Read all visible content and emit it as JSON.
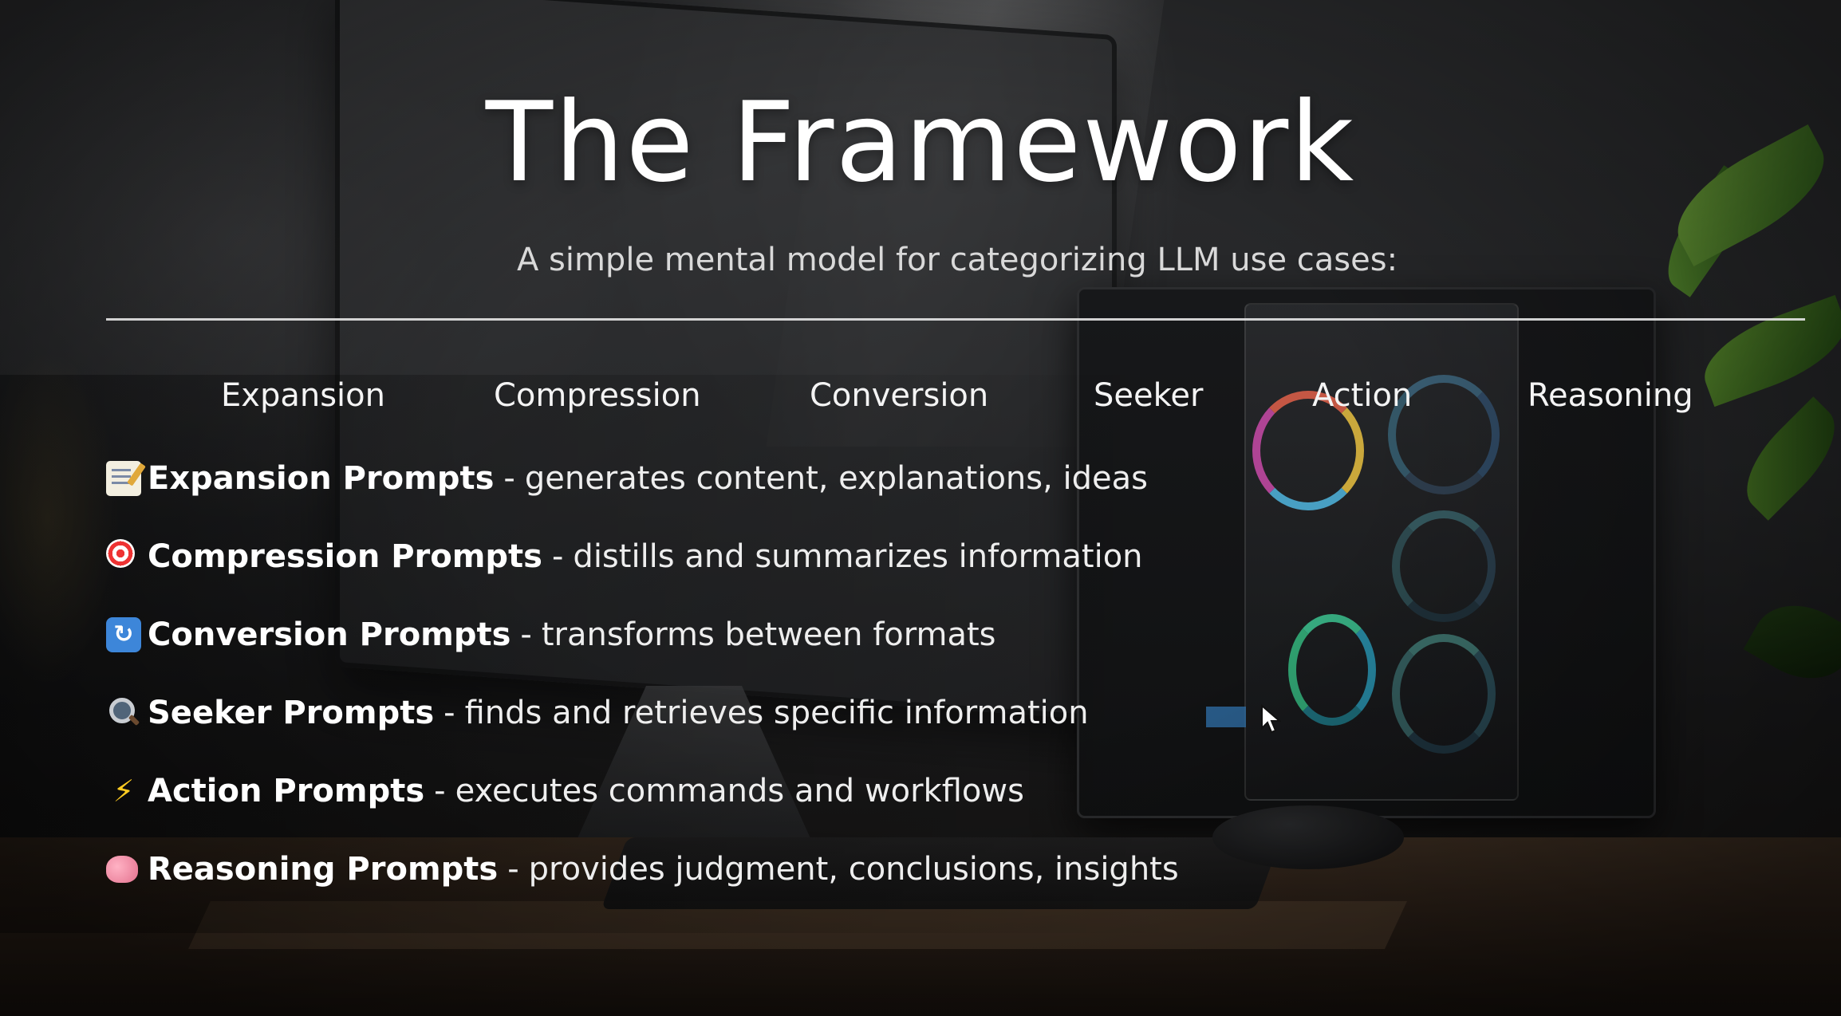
{
  "slide": {
    "title": "The Framework",
    "subtitle": "A simple mental model for categorizing LLM use cases:"
  },
  "categories": [
    "Expansion",
    "Compression",
    "Conversion",
    "Seeker",
    "Action",
    "Reasoning"
  ],
  "prompts": [
    {
      "icon": "memo-icon",
      "name": "Expansion Prompts",
      "separator": "-",
      "description": "generates content, explanations, ideas"
    },
    {
      "icon": "target-icon",
      "name": "Compression Prompts",
      "separator": "-",
      "description": "distills and summarizes information"
    },
    {
      "icon": "cycle-arrows-icon",
      "name": "Conversion Prompts",
      "separator": "-",
      "description": "transforms between formats"
    },
    {
      "icon": "magnifying-glass-icon",
      "name": "Seeker Prompts",
      "separator": "-",
      "description": "finds and retrieves specific information"
    },
    {
      "icon": "lightning-bolt-icon",
      "name": "Action Prompts",
      "separator": "-",
      "description": "executes commands and workflows"
    },
    {
      "icon": "brain-icon",
      "name": "Reasoning Prompts",
      "separator": "-",
      "description": "provides judgment, conclusions, insights"
    }
  ],
  "colors": {
    "text": "#ffffff",
    "divider": "#e6e6e6",
    "subtitle": "#d9d9d9"
  }
}
